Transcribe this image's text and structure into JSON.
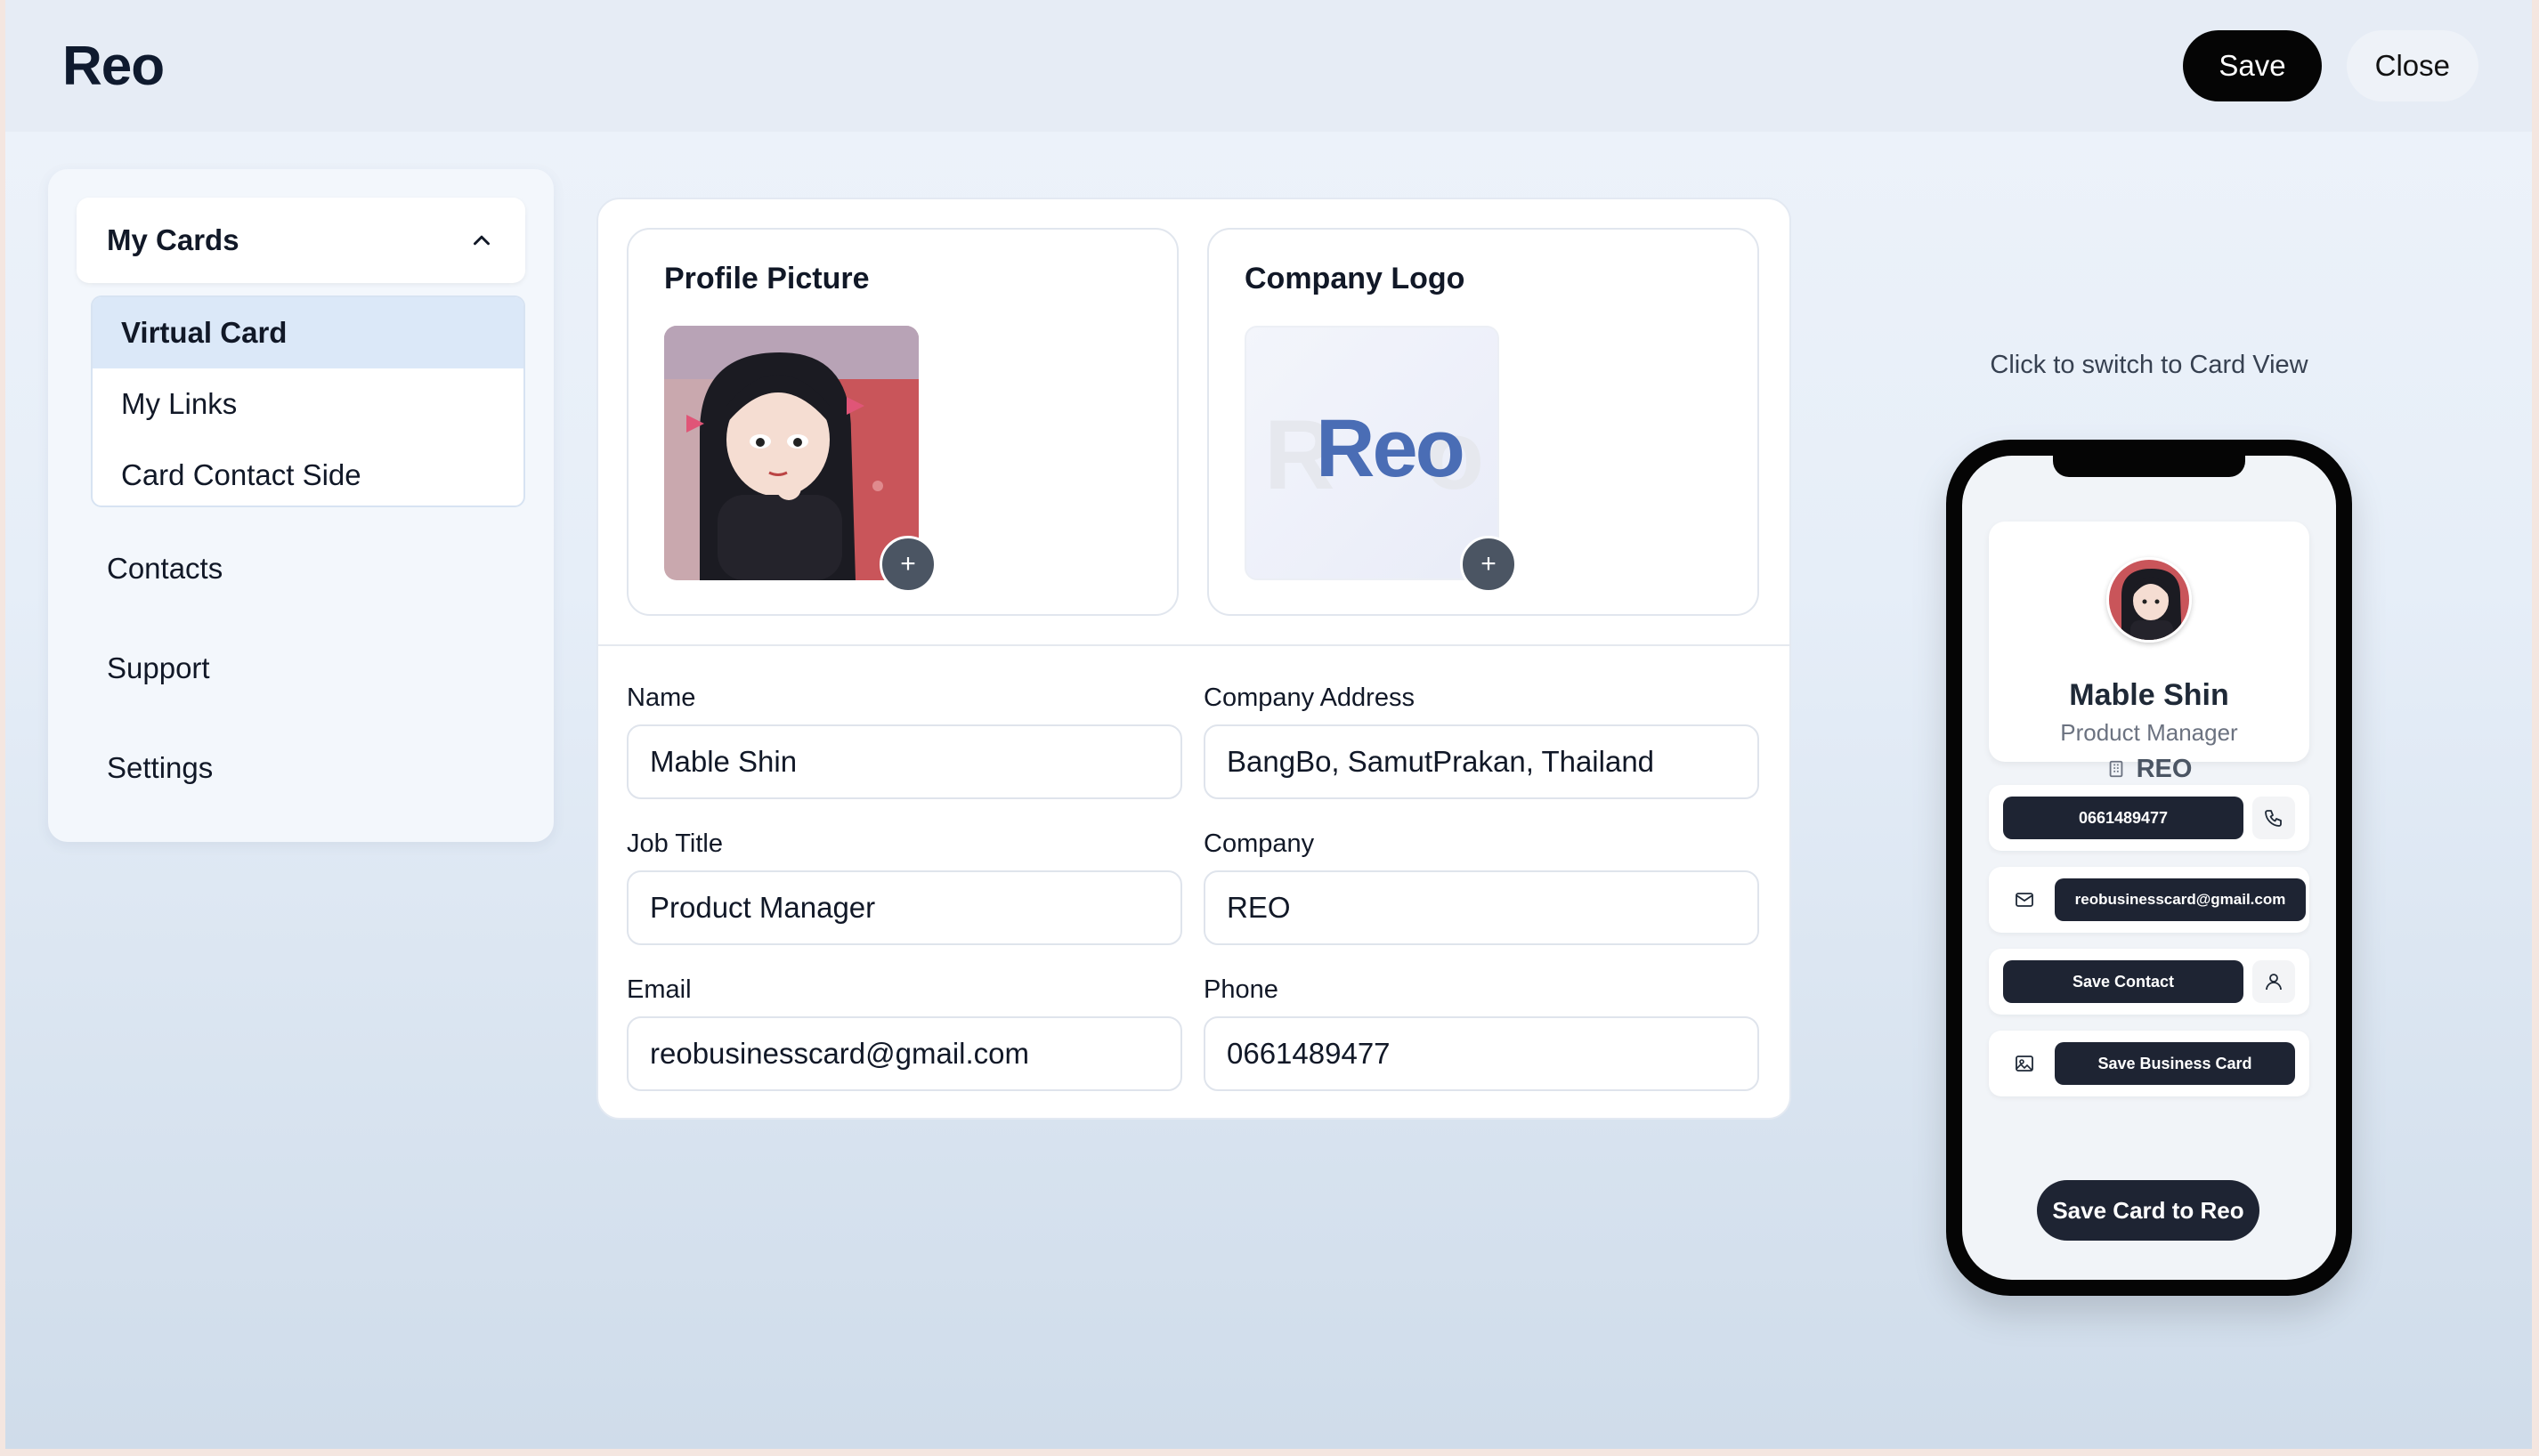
{
  "header": {
    "brand": "Reo",
    "save_label": "Save",
    "close_label": "Close"
  },
  "sidebar": {
    "group_label": "My Cards",
    "group_items": [
      {
        "label": "Virtual Card"
      },
      {
        "label": "My Links"
      },
      {
        "label": "Card Contact Side"
      }
    ],
    "items": [
      {
        "label": "Contacts"
      },
      {
        "label": "Support"
      },
      {
        "label": "Settings"
      }
    ]
  },
  "uploads": {
    "profile_label": "Profile Picture",
    "logo_label": "Company Logo",
    "logo_text": "Reo"
  },
  "form": {
    "name_label": "Name",
    "name_value": "Mable Shin",
    "address_label": "Company Address",
    "address_value": "BangBo, SamutPrakan, Thailand",
    "job_label": "Job Title",
    "job_value": "Product Manager",
    "company_label": "Company",
    "company_value": "REO",
    "email_label": "Email",
    "email_value": "reobusinesscard@gmail.com",
    "phone_label": "Phone",
    "phone_value": "0661489477"
  },
  "preview": {
    "hint": "Click to switch to Card View",
    "name": "Mable Shin",
    "title": "Product Manager",
    "company": "REO",
    "phone": "0661489477",
    "email": "reobusinesscard@gmail.com",
    "save_contact": "Save Contact",
    "save_business_card": "Save Business Card",
    "save_card_to_reo": "Save Card to Reo"
  },
  "icons": {
    "chevron": "chevron-up-icon",
    "plus": "plus-icon",
    "phone": "phone-icon",
    "mail": "mail-icon",
    "user": "user-icon",
    "image": "image-icon",
    "building": "building-icon"
  },
  "colors": {
    "primary_dark": "#050505",
    "pill_dark": "#1e2433",
    "active_item_bg": "#dbe8f8",
    "logo_blue": "#4a6db5"
  }
}
